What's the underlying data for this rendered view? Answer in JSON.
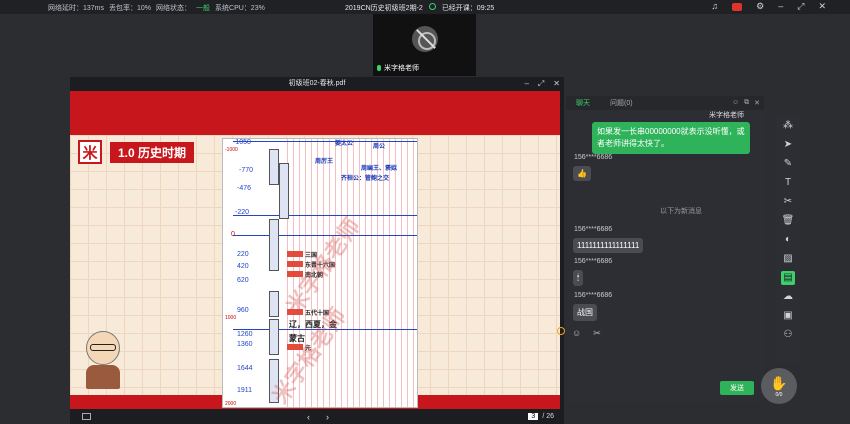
{
  "topbar": {
    "latency": "网络延时：137ms",
    "packet_loss": "丢包率：10%",
    "net_status_label": "网络状态：",
    "net_status_value": "一般",
    "cpu": "系统CPU：23%",
    "class_title": "2019CN历史初级班2期-2",
    "class_time": "已经开课：09:25"
  },
  "video": {
    "teacher_name": "米字格老师"
  },
  "pdf": {
    "filename": "初级班02-春秋.pdf",
    "slide_heading": "1.0 历史时期",
    "logo_char": "米",
    "page_current": "3",
    "page_total": "/ 26",
    "timeline": {
      "years": [
        "-1050",
        "-1000",
        "-770",
        "-476",
        "-220",
        "0",
        "220",
        "420",
        "620",
        "960",
        "1000",
        "1260",
        "1360",
        "1644",
        "1911",
        "2000"
      ],
      "labels": [
        "姜太公",
        "周公",
        "周厉王",
        "周幽王、褒姒",
        "齐桓公：管鲍之交",
        "三国",
        "东晋十六国",
        "南北朝",
        "五代十国",
        "辽，西夏，金",
        "蒙古",
        "元"
      ],
      "dynasties": [
        "西周",
        "春秋",
        "东周",
        "战国",
        "秦",
        "汉",
        "新",
        "西晋",
        "隋",
        "唐",
        "北宋",
        "南宋",
        "明",
        "清"
      ]
    },
    "watermark": "米字格老师"
  },
  "chat": {
    "tabs": [
      "聊天",
      "问题(0)"
    ],
    "teacher_name": "米字格老师",
    "teacher_msg": "如果发一长串00000000就表示没听懂，或者老师讲得太快了。",
    "messages": [
      {
        "sender": "156****6686",
        "text": "👍"
      },
      {
        "sender": "156****6686",
        "text": "1111111111111111"
      },
      {
        "sender": "156****6686",
        "text": "🕯"
      },
      {
        "sender": "156****6686",
        "text": "战国"
      }
    ],
    "divider": "以下为新消息",
    "send_label": "发送"
  },
  "hand": {
    "label": "0/0"
  }
}
